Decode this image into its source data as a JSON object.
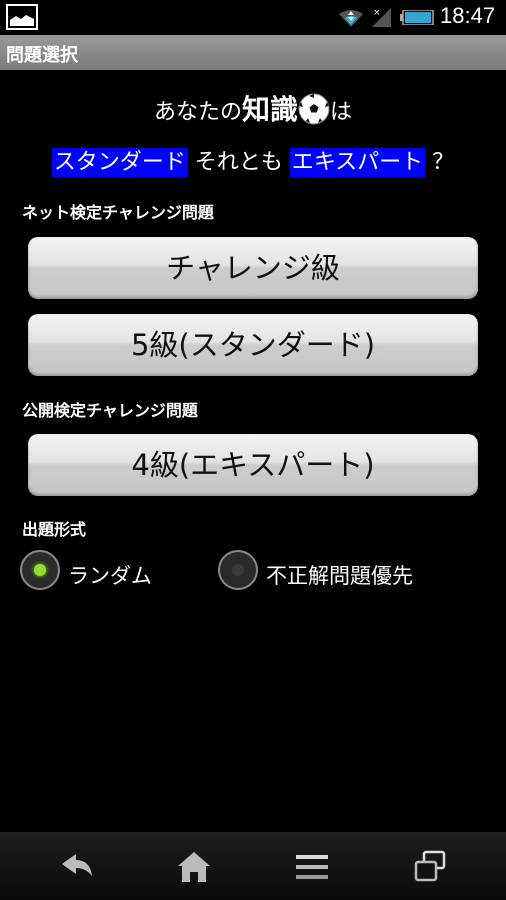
{
  "status_bar": {
    "time": "18:47",
    "icons": [
      "gallery-notification-icon",
      "wifi-icon",
      "no-signal-icon",
      "battery-icon"
    ]
  },
  "title_bar": {
    "title": "問題選択"
  },
  "headline": {
    "prefix": "あなたの",
    "bold": "知識",
    "icon": "soccer-ball-icon",
    "suffix": "は"
  },
  "subline": {
    "standard": "スタンダード",
    "middle": "それとも",
    "expert": "エキスパート",
    "question": "？",
    "highlight_color": "#0000ff"
  },
  "sections": {
    "net": {
      "label": "ネット検定チャレンジ問題",
      "buttons": [
        "チャレンジ級",
        "5級(スタンダード)"
      ]
    },
    "public": {
      "label": "公開検定チャレンジ問題",
      "buttons": [
        "4級(エキスパート)"
      ]
    }
  },
  "mode": {
    "label": "出題形式",
    "options": [
      {
        "label": "ランダム",
        "selected": true
      },
      {
        "label": "不正解問題優先",
        "selected": false
      }
    ],
    "selected_color": "#8fe02a"
  },
  "nav_bar": {
    "icons": [
      "back-icon",
      "home-icon",
      "menu-icon",
      "recent-apps-icon"
    ]
  }
}
